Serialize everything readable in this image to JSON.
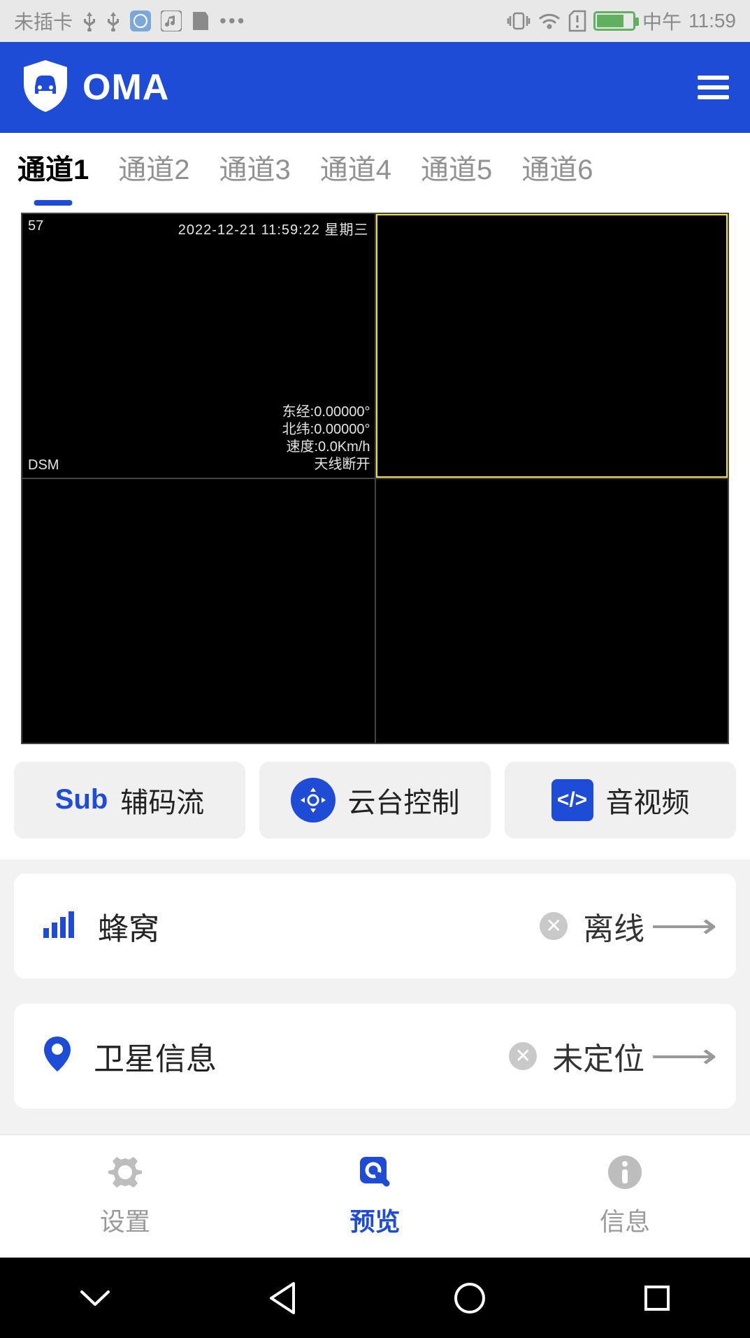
{
  "status_bar": {
    "sim_text": "未插卡",
    "time_prefix": "中午",
    "time": "11:59"
  },
  "header": {
    "app_title": "OMA"
  },
  "tabs": [
    {
      "label": "通道1",
      "active": true
    },
    {
      "label": "通道2",
      "active": false
    },
    {
      "label": "通道3",
      "active": false
    },
    {
      "label": "通道4",
      "active": false
    },
    {
      "label": "通道5",
      "active": false
    },
    {
      "label": "通道6",
      "active": false
    }
  ],
  "video": {
    "cell1": {
      "top_left": "57",
      "top_right": "2022-12-21 11:59:22 星期三",
      "bottom_left": "DSM",
      "info_lines": [
        "东经:0.00000°",
        "北纬:0.00000°",
        "速度:0.0Km/h",
        "天线断开"
      ]
    }
  },
  "controls": {
    "sub_text": "Sub",
    "sub_label": "辅码流",
    "ptz_label": "云台控制",
    "av_icon_text": "</>",
    "av_label": "音视频"
  },
  "cards": {
    "cellular": {
      "label": "蜂窝",
      "status": "离线"
    },
    "satellite": {
      "label": "卫星信息",
      "status": "未定位"
    }
  },
  "bottom_tabs": {
    "settings": "设置",
    "preview": "预览",
    "info": "信息"
  }
}
